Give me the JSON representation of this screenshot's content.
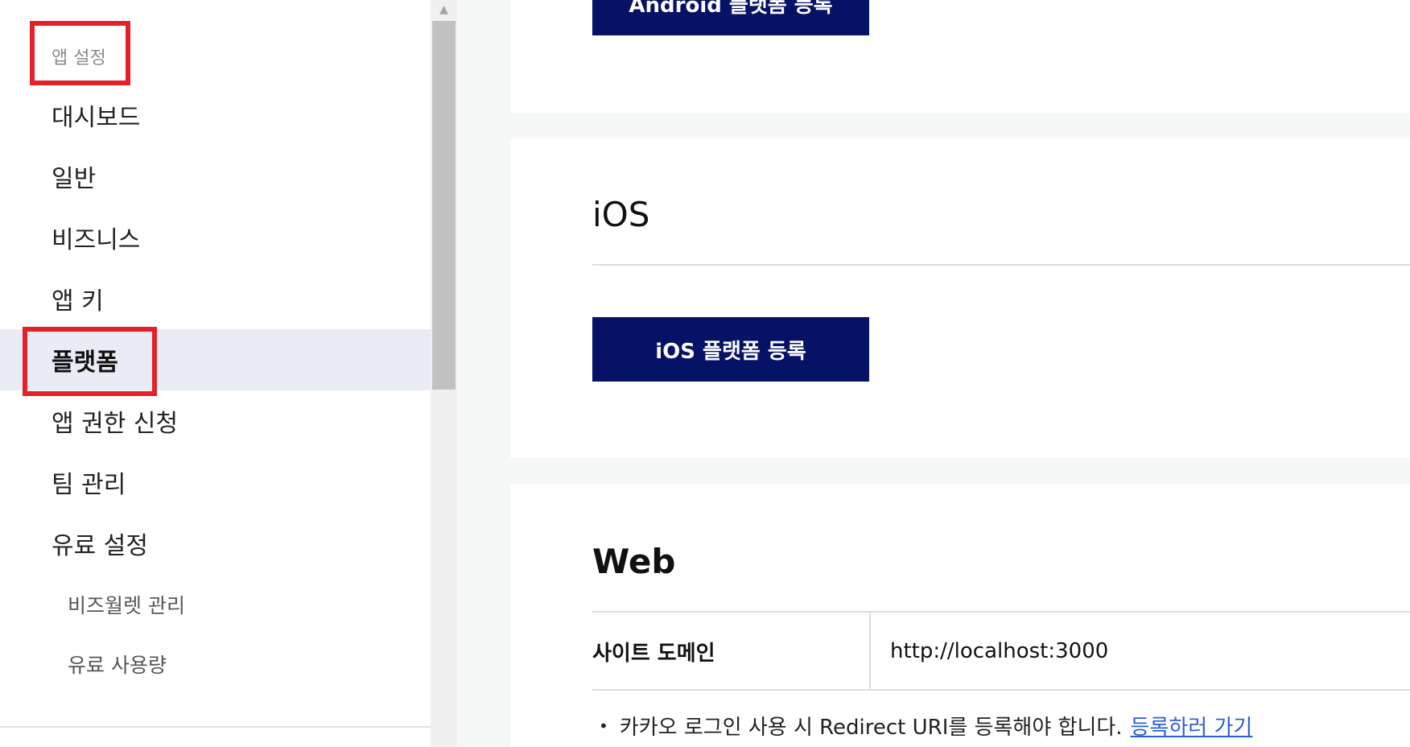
{
  "sidebar": {
    "section_title": "앱 설정",
    "items": [
      {
        "label": "대시보드"
      },
      {
        "label": "일반"
      },
      {
        "label": "비즈니스"
      },
      {
        "label": "앱 키"
      },
      {
        "label": "플랫폼",
        "active": true
      },
      {
        "label": "앱 권한 신청"
      },
      {
        "label": "팀 관리"
      },
      {
        "label": "유료 설정"
      }
    ],
    "sub_items": [
      {
        "label": "비즈월렛 관리"
      },
      {
        "label": "유료 사용량"
      }
    ]
  },
  "android": {
    "register_button": "Android 플랫폼 등록"
  },
  "ios": {
    "heading": "iOS",
    "register_button": "iOS 플랫폼 등록"
  },
  "web": {
    "heading": "Web",
    "domain_label": "사이트 도메인",
    "domain_value": "http://localhost:3000",
    "note_text": "카카오 로그인 사용 시 Redirect URI를 등록해야 합니다.",
    "note_link": "등록하러 가기"
  },
  "colors": {
    "primary_button": "#051266",
    "highlight_box": "#e32128",
    "active_item_bg": "#e9ecf5",
    "link": "#2b5fd9"
  }
}
